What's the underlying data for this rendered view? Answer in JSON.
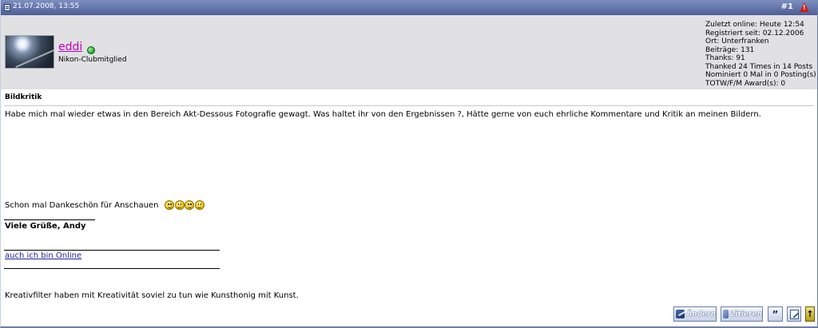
{
  "header": {
    "date": "21.07.2008, 13:55",
    "post_number": "#1",
    "icons": {
      "post": "post-doc-icon",
      "report": "report-warning-icon"
    }
  },
  "user": {
    "name": "eddi",
    "rank": "Nikon-Clubmitglied",
    "status": "online",
    "stats": [
      "Zuletzt online: Heute 12:54",
      "Registriert seit: 02.12.2006",
      "Ort: Unterfranken",
      "Beiträge: 131",
      "Thanks: 91",
      "Thanked 24 Times in 14 Posts",
      "Nominiert 0 Mal in 0 Posting(s)",
      "TOTW/F/M Award(s): 0"
    ]
  },
  "post": {
    "title": "Bildkritik",
    "text_1": "Habe mich mal wieder etwas in den Bereich Akt-Dessous Fotografie gewagt. Was haltet ihr von den Ergebnissen ?, Hätte gerne von euch ehrliche Kommentare und Kritik an meinen Bildern.",
    "text_2": "Schon mal Dankeschön für Anschauen",
    "smiley_count": 4
  },
  "signature": {
    "greeting": "Viele Grüße, Andy",
    "link": "auch ich bin Online",
    "quote": "Kreativfilter haben mit Kreativität soviel zu tun wie Kunsthonig mit Kunst."
  },
  "buttons": {
    "edit": "Ändern",
    "quote": "Zitieren",
    "multiquote_icon": "multi-quote-icon",
    "quickreply_icon": "quick-reply-icon",
    "top_icon": "scroll-top-icon"
  },
  "colors": {
    "header_bar": "#5a6ca3",
    "user_panel": "#e1e1e3",
    "username": "#c000c0",
    "link": "#22229c"
  }
}
